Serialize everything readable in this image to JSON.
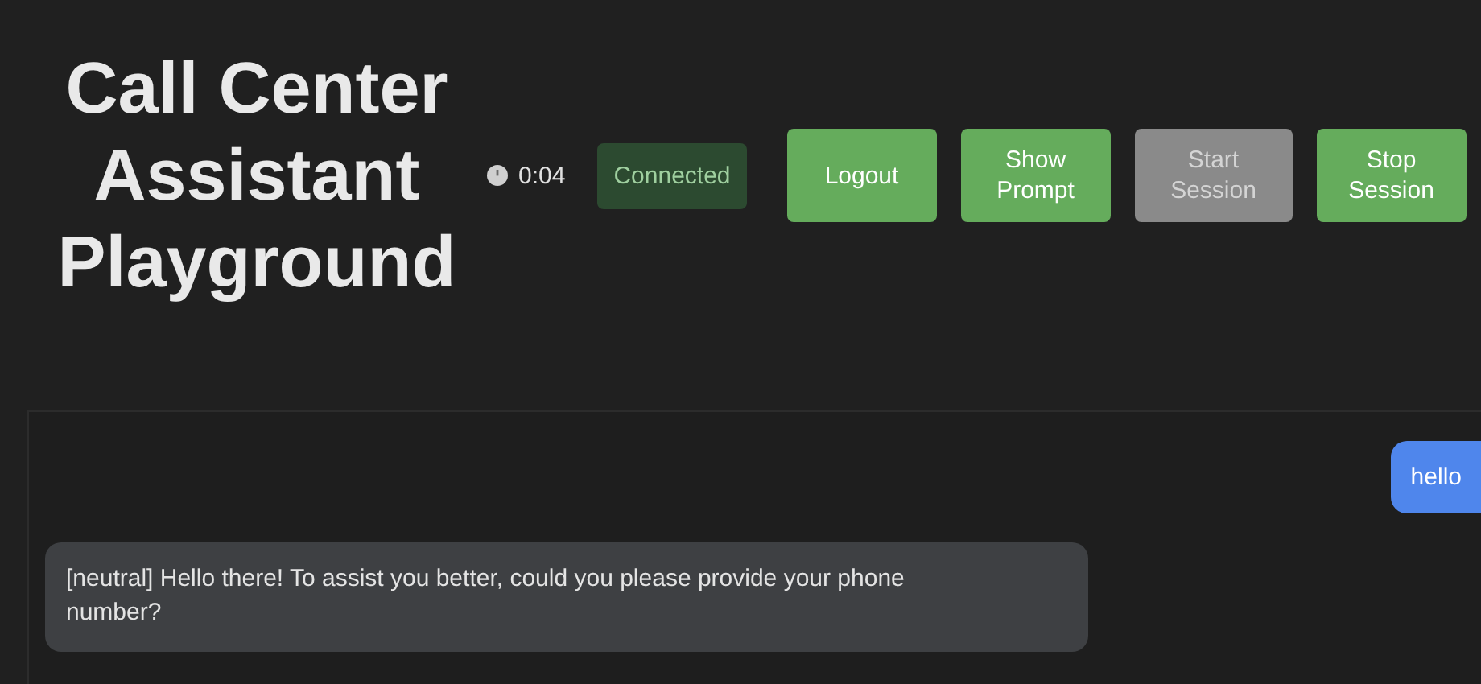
{
  "title": "Call Center Assistant Playground",
  "timer": "0:04",
  "status": {
    "label": "Connected",
    "connected": true
  },
  "buttons": [
    {
      "label": "Logout",
      "disabled": false
    },
    {
      "label": "Show Prompt",
      "disabled": false
    },
    {
      "label": "Start Session",
      "disabled": true
    },
    {
      "label": "Stop Session",
      "disabled": false
    }
  ],
  "messages": [
    {
      "kind": "user",
      "text": "hello"
    },
    {
      "kind": "reply",
      "text": "[neutral] Hello there! To assist you better, could you please provide your phone number?"
    }
  ]
}
